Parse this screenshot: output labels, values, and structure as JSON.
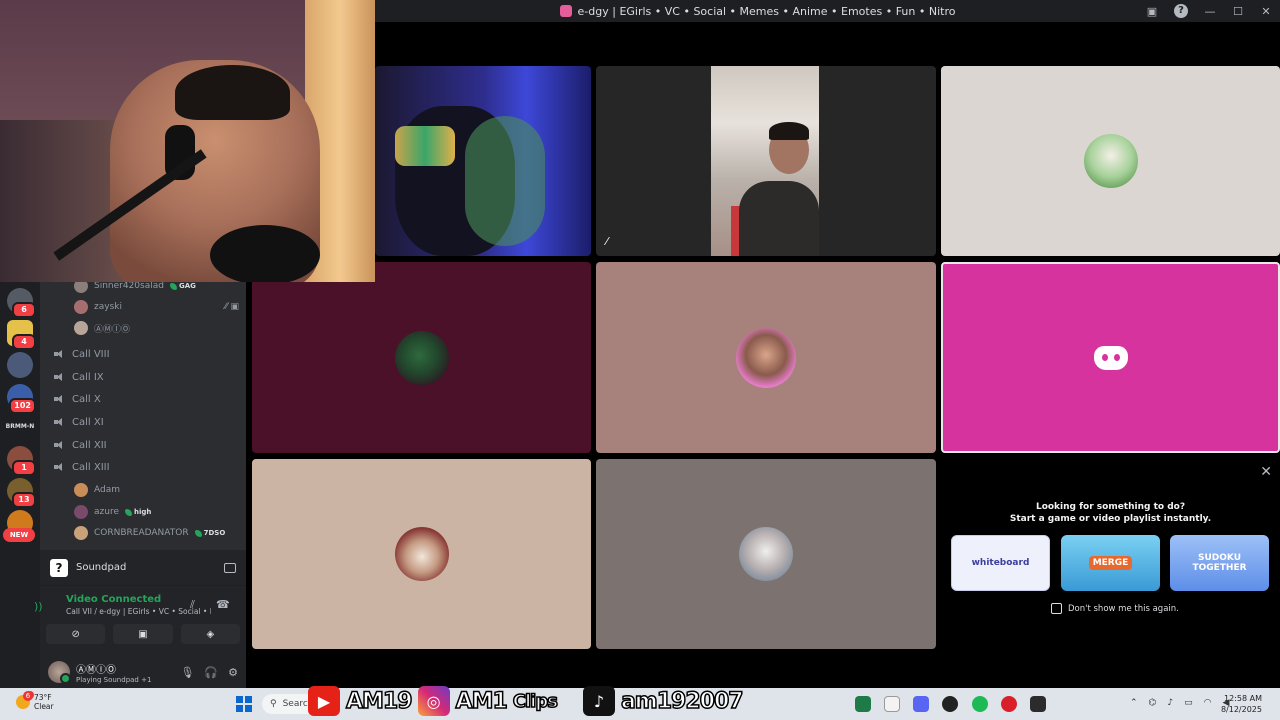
{
  "window": {
    "title": "e-dgy | EGirls • VC • Social • Memes • Anime • Emotes • Fun • Nitro",
    "help_label": "?",
    "minimize": "—",
    "maximize": "☐",
    "close": "✕"
  },
  "server_rail": {
    "items": [
      {
        "badge": "6",
        "color": "#555b64"
      },
      {
        "badge": "4",
        "color": "#e6c14a"
      },
      {
        "badge": "",
        "color": "#4c5a7a"
      },
      {
        "badge": "102",
        "color": "#3a5fa8"
      },
      {
        "label": "BRMM-N"
      },
      {
        "badge": "1",
        "color": "#8a4d3e"
      },
      {
        "badge": "13",
        "color": "#7a5f2e"
      },
      {
        "badge": "",
        "color": "#d07a1e"
      }
    ],
    "new_label": "NEW"
  },
  "channels": {
    "top_members": [
      {
        "name": "Sinner420salad",
        "tag": "GAG",
        "color": "#8a7f7a"
      },
      {
        "name": "zayski",
        "tag": "",
        "color": "#a66f6f",
        "icons": "⁄⁄  ▣"
      },
      {
        "name": "ⒶⓂⒾⓄ",
        "tag": "",
        "color": "#b7a59a"
      }
    ],
    "voice_channels": [
      "Call VIII",
      "Call IX",
      "Call X",
      "Call XI",
      "Call XII",
      "Call XIII"
    ],
    "bottom_members": [
      {
        "name": "Adam",
        "tag": "",
        "color": "#c98e58"
      },
      {
        "name": "azure",
        "tag": "high",
        "color": "#7a4a6b"
      },
      {
        "name": "CORNBREADANATOR",
        "tag": "7DSO",
        "color": "#c9a27a"
      }
    ]
  },
  "panel": {
    "soundpad_icon": "?",
    "soundpad_label": "Soundpad",
    "video_status": "Video Connected",
    "video_channel": "Call VII / e-dgy | EGirls • VC • Social • Me...",
    "user_name": "ⒶⓂⒾⓄ",
    "user_status": "Playing Soundpad +1"
  },
  "tiles": [
    {
      "id": "blue-room",
      "bg": "#1a1a3a"
    },
    {
      "id": "gym",
      "bg": "#2a2a2a"
    },
    {
      "id": "cartoon",
      "bg": "#dcd6d2"
    },
    {
      "id": "maroon",
      "bg": "#4a1128"
    },
    {
      "id": "pink-frame",
      "bg": "#a7817b"
    },
    {
      "id": "discord",
      "bg": "#d6339e"
    },
    {
      "id": "tan",
      "bg": "#cbb4a4"
    },
    {
      "id": "gray",
      "bg": "#7c726f"
    }
  ],
  "activity": {
    "line1": "Looking for something to do?",
    "line2": "Start a game or video playlist instantly.",
    "cards": [
      {
        "name": "whiteboard",
        "bg": "#eef0fb",
        "fg": "#3b3f9e"
      },
      {
        "name": "MERGE",
        "bg": "#5ab8e6",
        "fg": "#ffffff"
      },
      {
        "name": "SUDOKU TOGETHER",
        "bg": "#7aa8ee",
        "fg": "#ffffff"
      }
    ],
    "dont_show": "Don't show me this again.",
    "close": "✕"
  },
  "taskbar": {
    "temp": "73°F",
    "condition": "Clear",
    "weather_badge": "6",
    "search_placeholder": "Search",
    "overlay_youtube": "AM19",
    "overlay_instagram": "AM1",
    "overlay_clips": "Clips",
    "overlay_tiktok": "am192007",
    "time": "12:58 AM",
    "date": "8/12/2025"
  },
  "colors": {
    "discord_green": "#23a55a",
    "discord_red": "#f23f43",
    "discord_blurple": "#5865f2"
  }
}
